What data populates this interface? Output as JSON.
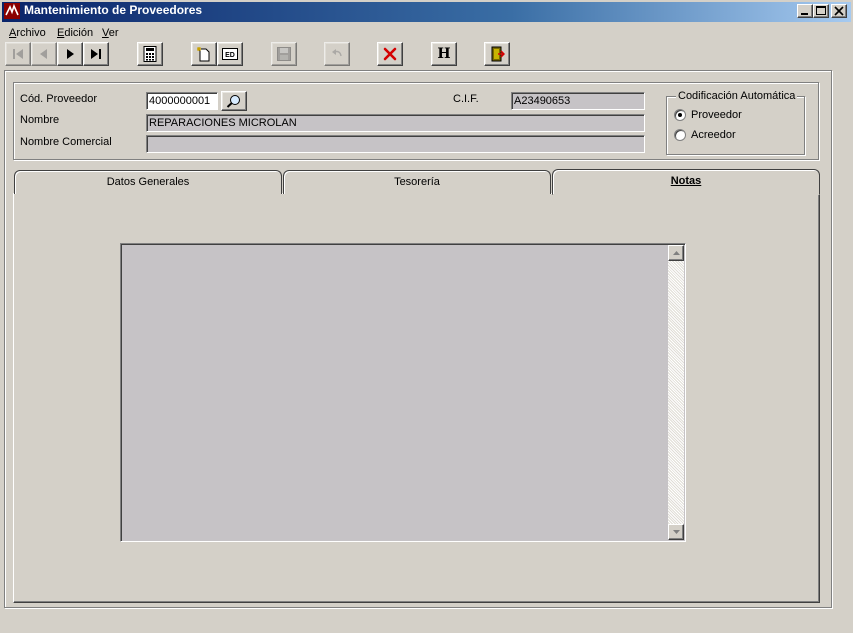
{
  "window": {
    "title": "Mantenimiento de Proveedores",
    "controls": {
      "minimize": "_",
      "maximize": "□",
      "close": "×"
    }
  },
  "menu": [
    {
      "accel": "A",
      "rest": "rchivo"
    },
    {
      "accel": "E",
      "rest": "dición"
    },
    {
      "accel": "V",
      "rest": "er"
    }
  ],
  "toolbar": {
    "icons": [
      "first-record-icon",
      "previous-record-icon",
      "next-record-icon",
      "last-record-icon",
      "calculator-icon",
      "new-record-icon",
      "edit-record-icon",
      "save-icon",
      "undo-icon",
      "delete-icon",
      "history-icon",
      "exit-icon"
    ],
    "history_glyph": "H"
  },
  "header": {
    "cod_proveedor_label": "Cód. Proveedor",
    "cod_proveedor_value": "4000000001",
    "cif_label": "C.I.F.",
    "cif_value": "A23490653",
    "nombre_label": "Nombre",
    "nombre_value": "REPARACIONES MICROLAN",
    "nombre_comercial_label": "Nombre Comercial",
    "nombre_comercial_value": ""
  },
  "codificacion": {
    "title": "Codificación Automática",
    "options": [
      {
        "label": "Proveedor",
        "selected": true
      },
      {
        "label": "Acreedor",
        "selected": false
      }
    ]
  },
  "tabs": [
    {
      "label": "Datos Generales",
      "active": false
    },
    {
      "label": "Tesorería",
      "active": false
    },
    {
      "label": "Notas",
      "active": true
    }
  ],
  "notas": {
    "text": ""
  },
  "colors": {
    "titlebar_start": "#0a246a",
    "face": "#d4d0c8",
    "field": "#c6c3c6",
    "delete_red": "#d40000"
  }
}
